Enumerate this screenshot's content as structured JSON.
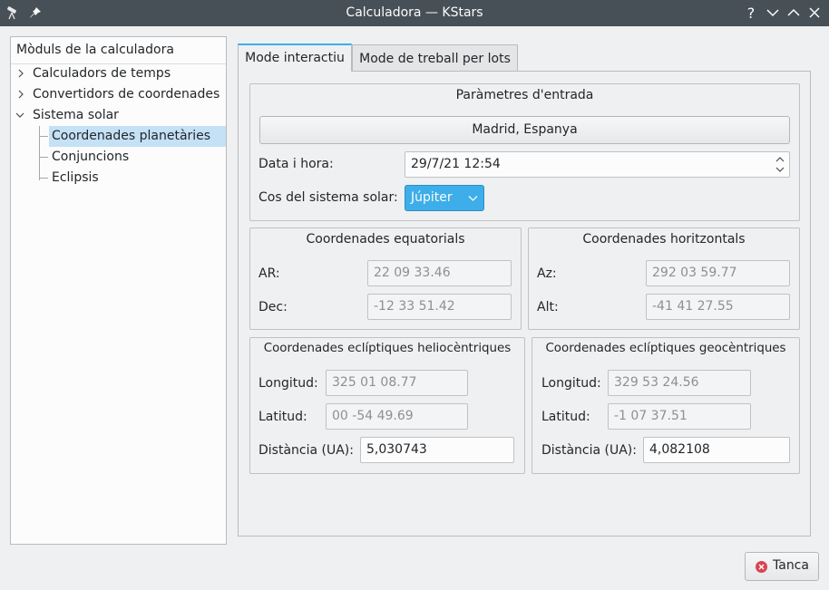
{
  "window": {
    "title": "Calculadora — KStars",
    "help_glyph": "?"
  },
  "sidebar": {
    "header": "Mòduls de la calculadora",
    "items": [
      {
        "label": "Calculadors de temps"
      },
      {
        "label": "Convertidors de coordenades"
      },
      {
        "label": "Sistema solar"
      },
      {
        "label": "Coordenades planetàries"
      },
      {
        "label": "Conjuncions"
      },
      {
        "label": "Eclipsis"
      }
    ]
  },
  "tabs": [
    {
      "label": "Mode interactiu"
    },
    {
      "label": "Mode de treball per lots"
    }
  ],
  "input_params": {
    "title": "Paràmetres d'entrada",
    "location_button": "Madrid, Espanya",
    "datetime_label": "Data i hora:",
    "datetime_value": "29/7/21 12:54",
    "body_label": "Cos del sistema solar:",
    "body_value": "Júpiter"
  },
  "equatorial": {
    "title": "Coordenades equatorials",
    "ra_label": "AR:",
    "ra_value": "22 09 33.46",
    "dec_label": "Dec:",
    "dec_value": "-12 33 51.42"
  },
  "horizontal": {
    "title": "Coordenades horitzontals",
    "az_label": "Az:",
    "az_value": "292 03 59.77",
    "alt_label": "Alt:",
    "alt_value": "-41 41 27.55"
  },
  "heliocentric": {
    "title": "Coordenades eclíptiques heliocèntriques",
    "lon_label": "Longitud:",
    "lon_value": "325 01 08.77",
    "lat_label": "Latitud:",
    "lat_value": "00 -54 49.69",
    "dist_label": "Distància (UA):",
    "dist_value": "5,030743"
  },
  "geocentric": {
    "title": "Coordenades eclíptiques geocèntriques",
    "lon_label": "Longitud:",
    "lon_value": "329 53 24.56",
    "lat_label": "Latitud:",
    "lat_value": "-1 07 37.51",
    "dist_label": "Distància (UA):",
    "dist_value": "4,082108"
  },
  "footer": {
    "close_label": "Tanca"
  },
  "icons": {
    "app": "telescope-icon",
    "pin": "pin-icon",
    "help": "help-icon",
    "minimize": "chevron-down-icon",
    "maximize": "chevron-up-icon",
    "close": "close-icon",
    "cancel": "cancel-icon"
  },
  "colors": {
    "titlebar": "#475057",
    "accent": "#3daee9",
    "selection": "#c4e1f6",
    "cancel_red": "#da4453"
  }
}
